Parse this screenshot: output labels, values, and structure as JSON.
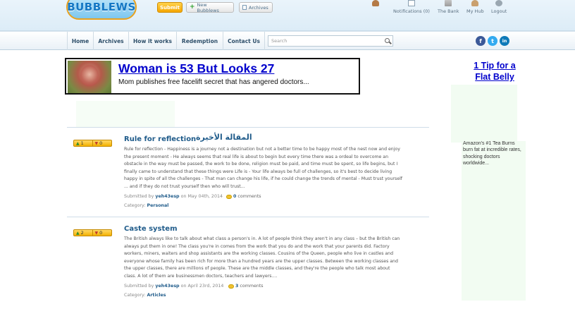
{
  "header": {
    "logo_text": "BUBBLEWS",
    "submit_label": "Submit",
    "new_bubblews_label": "New Bubblews",
    "archives_label": "Archives",
    "notifications_label": "Notifications (0)",
    "bank_label": "The Bank",
    "hub_label": "My Hub",
    "logout_label": "Logout"
  },
  "nav": {
    "items": [
      "Home",
      "Archives",
      "How it works",
      "Redemption",
      "Contact Us"
    ],
    "search_placeholder": "Search",
    "social": {
      "facebook": "f",
      "twitter": "t",
      "linkedin": "in"
    }
  },
  "ad": {
    "title": "Woman is 53 But Looks 27",
    "subtitle": "Mom publishes free facelift secret that has angered doctors..."
  },
  "sidebar_ad": {
    "title": "1 Tip for a Flat Belly",
    "text": "Amazon's #1 Tea Burns burn fat at incredible rates, shocking doctors worldwide..."
  },
  "posts": [
    {
      "up_votes": "1",
      "down_votes": "0",
      "title": "Rule for reflection",
      "title_arabic": "المقالة الأخيرة",
      "body": "Rule for reflection - Happiness is a journey not a destination but not a better time to be happy most of the nest now and enjoy the present moment - He always seems that real life is about to begin but every time there was a ordeal to overcome an obstacle in the way must be passed, the work to be done, religion must be paid, and time must be spent, so life begins, but I finally came to understand that these things were Life is - Your life always be full of challenges, so it's best to decide living happy in spite of all the challenges - That man can change his life, if he could change the trends of mental - Must trust yourself ... and if they do not trust yourself then who will trust...",
      "submitted_prefix": "Submitted by",
      "author": "yeh43esp",
      "date": "on May 04th, 2014",
      "comment_count": "0",
      "comment_label": "comments",
      "category_label": "Category:",
      "category": "Personal"
    },
    {
      "up_votes": "2",
      "down_votes": "0",
      "title": "Caste system",
      "body": "The British always like to talk about what class a person's in. A lot of people think they aren't in any class – but the British can always put them in one! The class you're in comes from the work that you do and the work that your parents did. Factory workers, miners, waiters and shop assistants are the working classes. Cousins of the Queen, people who live in castles and everyone whose family has been rich for more than a hundred years are the upper classes. Between the working classes and the upper classes, there are millions of people. These are the middle classes, and they're the people who talk most about class. A lot of them are businessmen doctors, teachers and lawyers....",
      "submitted_prefix": "Submitted by",
      "author": "yeh43esp",
      "date": "on April 23rd, 2014",
      "comment_count": "3",
      "comment_label": "comments",
      "category_label": "Category:",
      "category": "Articles"
    }
  ]
}
